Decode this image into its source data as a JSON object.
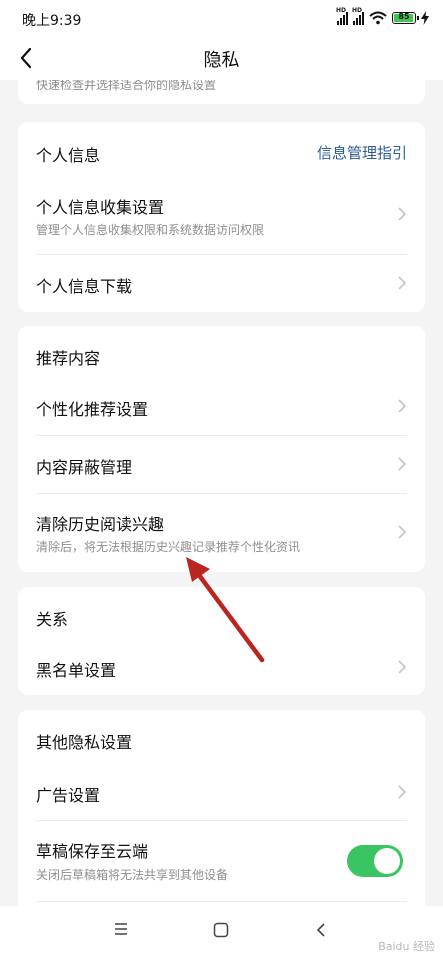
{
  "status": {
    "time": "晚上9:39",
    "battery": "85",
    "network_badge": "HD"
  },
  "nav": {
    "title": "隐私"
  },
  "clipped_card": {
    "text": "快速检查并选择适合你的隐私设置"
  },
  "personal": {
    "title": "个人信息",
    "link": "信息管理指引",
    "items": [
      {
        "label": "个人信息收集设置",
        "sub": "管理个人信息收集权限和系统数据访问权限"
      },
      {
        "label": "个人信息下载"
      }
    ]
  },
  "recommend": {
    "title": "推荐内容",
    "items": [
      {
        "label": "个性化推荐设置"
      },
      {
        "label": "内容屏蔽管理"
      },
      {
        "label": "清除历史阅读兴趣",
        "sub": "清除后，将无法根据历史兴趣记录推荐个性化资讯"
      }
    ]
  },
  "relation": {
    "title": "关系",
    "items": [
      {
        "label": "黑名单设置"
      }
    ]
  },
  "other": {
    "title": "其他隐私设置",
    "items": [
      {
        "label": "广告设置"
      },
      {
        "label": "草稿保存至云端",
        "sub": "关闭后草稿箱将无法共享到其他设备",
        "toggle_on": true
      }
    ]
  },
  "colors": {
    "accent_link": "#2e5b94",
    "toggle_on": "#3ac562",
    "annotation_arrow": "#b8261f"
  },
  "icons": [
    "back-icon",
    "chevron-right-icon",
    "menu-icon",
    "home-icon",
    "back-nav-icon",
    "wifi-icon",
    "signal-icon",
    "battery-icon",
    "charging-icon"
  ],
  "watermark": "Baidu 经验"
}
